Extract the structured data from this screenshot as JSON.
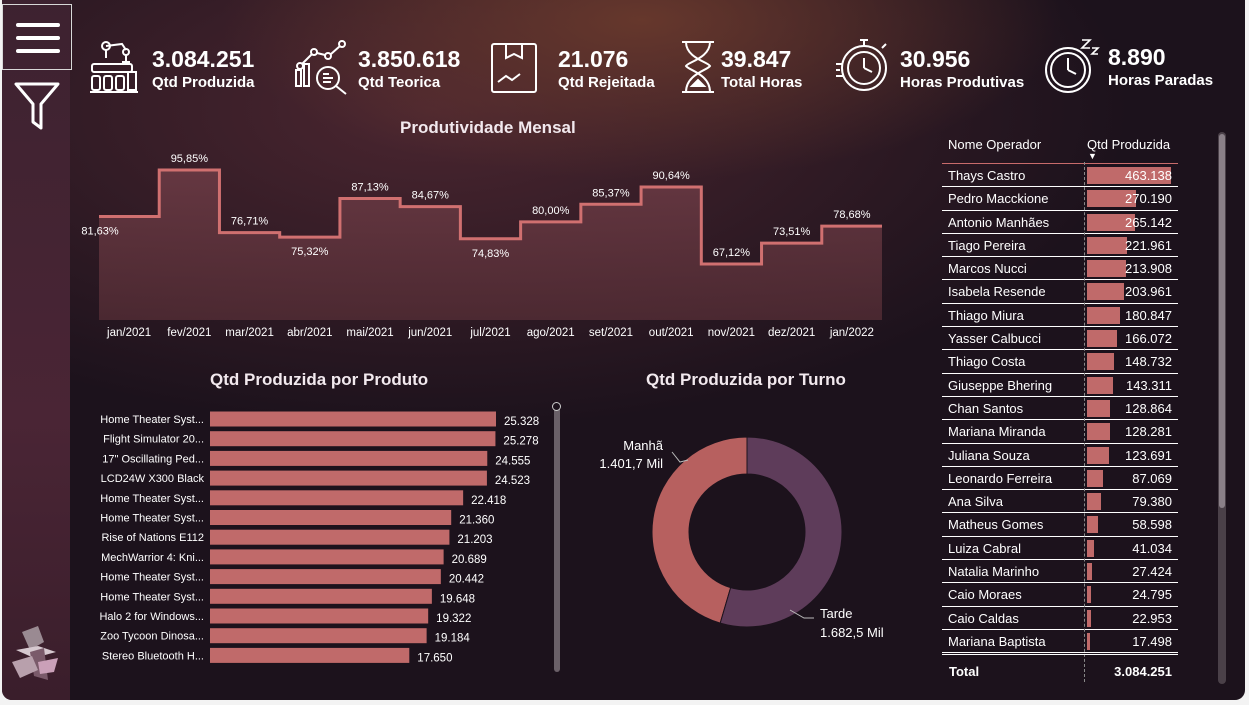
{
  "kpis": [
    {
      "value": "3.084.251",
      "label": "Qtd Produzida",
      "icon": "factory-robot-icon"
    },
    {
      "value": "3.850.618",
      "label": "Qtd Teorica",
      "icon": "analytics-search-icon"
    },
    {
      "value": "21.076",
      "label": "Qtd Rejeitada",
      "icon": "box-icon"
    },
    {
      "value": "39.847",
      "label": "Total Horas",
      "icon": "hourglass-icon"
    },
    {
      "value": "30.956",
      "label": "Horas Produtivas",
      "icon": "stopwatch-icon"
    },
    {
      "value": "8.890",
      "label": "Horas Paradas",
      "icon": "sleeping-clock-icon"
    }
  ],
  "colors": {
    "bar": "#c06a6a",
    "area": "#5a3038",
    "line": "#d07070",
    "donut_manha": "#b7605f",
    "donut_tarde": "#5e3c5a"
  },
  "monthly": {
    "title": "Produtividade Mensal",
    "chart_data": {
      "type": "area",
      "categories": [
        "jan/2021",
        "fev/2021",
        "mar/2021",
        "abr/2021",
        "mai/2021",
        "jun/2021",
        "jul/2021",
        "ago/2021",
        "set/2021",
        "out/2021",
        "nov/2021",
        "dez/2021",
        "jan/2022"
      ],
      "values": [
        81.63,
        95.85,
        76.71,
        75.32,
        87.13,
        84.67,
        74.83,
        80.0,
        85.37,
        90.64,
        67.12,
        73.51,
        78.68
      ],
      "labels": [
        "81,63%",
        "95,85%",
        "76,71%",
        "75,32%",
        "87,13%",
        "84,67%",
        "74,83%",
        "80,00%",
        "85,37%",
        "90,64%",
        "67,12%",
        "73,51%",
        "78,68%"
      ]
    }
  },
  "products": {
    "title": "Qtd Produzida por Produto",
    "chart_data": {
      "type": "bar",
      "categories": [
        "Home Theater Syst...",
        "Flight Simulator 20...",
        "17\" Oscillating Ped...",
        "LCD24W X300 Black",
        "Home Theater Syst...",
        "Home Theater Syst...",
        "Rise of Nations E112",
        "MechWarrior 4: Kni...",
        "Home Theater Syst...",
        "Home Theater Syst...",
        "Halo 2 for Windows...",
        "Zoo Tycoon Dinosa...",
        "Stereo Bluetooth H..."
      ],
      "values": [
        25328,
        25278,
        24555,
        24523,
        22418,
        21360,
        21203,
        20689,
        20442,
        19648,
        19322,
        19184,
        17650
      ],
      "labels": [
        "25.328",
        "25.278",
        "24.555",
        "24.523",
        "22.418",
        "21.360",
        "21.203",
        "20.689",
        "20.442",
        "19.648",
        "19.322",
        "19.184",
        "17.650"
      ]
    }
  },
  "shifts": {
    "title": "Qtd Produzida por Turno",
    "chart_data": {
      "type": "pie",
      "slices": [
        {
          "name": "Manhã",
          "value": 1401.7,
          "label": "1.401,7 Mil"
        },
        {
          "name": "Tarde",
          "value": 1682.5,
          "label": "1.682,5 Mil"
        }
      ]
    }
  },
  "operators": {
    "col_name": "Nome Operador",
    "col_value": "Qtd Produzida",
    "rows": [
      {
        "name": "Thays Castro",
        "value": 463138,
        "display": "463.138"
      },
      {
        "name": "Pedro Macckione",
        "value": 270190,
        "display": "270.190"
      },
      {
        "name": "Antonio Manhães",
        "value": 265142,
        "display": "265.142"
      },
      {
        "name": "Tiago Pereira",
        "value": 221961,
        "display": "221.961"
      },
      {
        "name": "Marcos Nucci",
        "value": 213908,
        "display": "213.908"
      },
      {
        "name": "Isabela Resende",
        "value": 203961,
        "display": "203.961"
      },
      {
        "name": "Thiago Miura",
        "value": 180847,
        "display": "180.847"
      },
      {
        "name": "Yasser Calbucci",
        "value": 166072,
        "display": "166.072"
      },
      {
        "name": "Thiago Costa",
        "value": 148732,
        "display": "148.732"
      },
      {
        "name": "Giuseppe Bhering",
        "value": 143311,
        "display": "143.311"
      },
      {
        "name": "Chan Santos",
        "value": 128864,
        "display": "128.864"
      },
      {
        "name": "Mariana Miranda",
        "value": 128281,
        "display": "128.281"
      },
      {
        "name": "Juliana Souza",
        "value": 123691,
        "display": "123.691"
      },
      {
        "name": "Leonardo Ferreira",
        "value": 87069,
        "display": "87.069"
      },
      {
        "name": "Ana Silva",
        "value": 79380,
        "display": "79.380"
      },
      {
        "name": "Matheus Gomes",
        "value": 58598,
        "display": "58.598"
      },
      {
        "name": "Luiza Cabral",
        "value": 41034,
        "display": "41.034"
      },
      {
        "name": "Natalia Marinho",
        "value": 27424,
        "display": "27.424"
      },
      {
        "name": "Caio Moraes",
        "value": 24795,
        "display": "24.795"
      },
      {
        "name": "Caio Caldas",
        "value": 22953,
        "display": "22.953"
      },
      {
        "name": "Mariana Baptista",
        "value": 17498,
        "display": "17.498"
      }
    ],
    "total_label": "Total",
    "total_value": "3.084.251"
  }
}
